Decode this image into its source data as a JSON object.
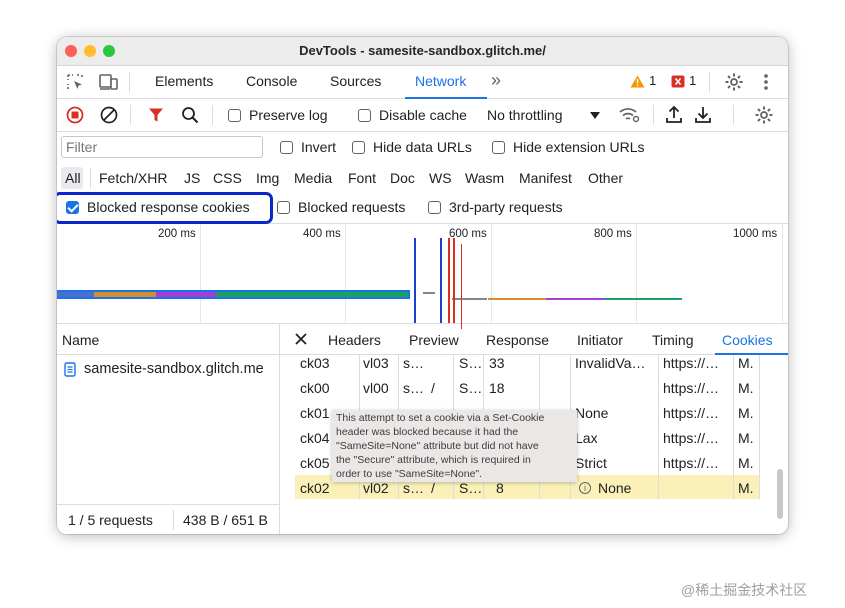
{
  "window": {
    "title": "DevTools - samesite-sandbox.glitch.me/"
  },
  "main_tabs": {
    "items": [
      "Elements",
      "Console",
      "Sources",
      "Network"
    ],
    "active": "Network",
    "more": "»",
    "warnings": "1",
    "errors": "1"
  },
  "toolbar": {
    "preserve_log": "Preserve log",
    "disable_cache": "Disable cache",
    "throttling": "No throttling"
  },
  "filters": {
    "placeholder": "Filter",
    "invert": "Invert",
    "hide_data_urls": "Hide data URLs",
    "hide_extension_urls": "Hide extension URLs",
    "types": [
      "All",
      "Fetch/XHR",
      "JS",
      "CSS",
      "Img",
      "Media",
      "Font",
      "Doc",
      "WS",
      "Wasm",
      "Manifest",
      "Other"
    ],
    "blocked_response_cookies": "Blocked response cookies",
    "blocked_requests": "Blocked requests",
    "third_party_requests": "3rd-party requests"
  },
  "timeline": {
    "ticks": [
      "200 ms",
      "400 ms",
      "600 ms",
      "800 ms",
      "1000 ms"
    ],
    "colors": {
      "blue": "#4a6fd1",
      "orange": "#d98c2b",
      "purple": "#a33fd4",
      "green": "#1aa260",
      "red": "#d93025"
    }
  },
  "requests": {
    "header": "Name",
    "items": [
      "samesite-sandbox.glitch.me"
    ],
    "status": "1 / 5 requests",
    "size": "438 B / 651 B"
  },
  "detail_tabs": {
    "items": [
      "Headers",
      "Preview",
      "Response",
      "Initiator",
      "Timing",
      "Cookies"
    ],
    "active": "Cookies"
  },
  "cookies": {
    "rows": [
      {
        "name": "ck03",
        "value": "vl03",
        "domain": "s…",
        "path": "",
        "expires": "S…",
        "size": "33",
        "samesite": "InvalidVa…",
        "partition": "https://…",
        "priority": "M.",
        "info": false
      },
      {
        "name": "ck00",
        "value": "vl00",
        "domain": "s…",
        "path": "/",
        "expires": "S…",
        "size": "18",
        "samesite": "",
        "partition": "https://…",
        "priority": "M.",
        "info": false
      },
      {
        "name": "ck01",
        "value": "",
        "domain": "",
        "path": "",
        "expires": "",
        "size": "",
        "samesite": "None",
        "partition": "https://…",
        "priority": "M.",
        "info": false
      },
      {
        "name": "ck04",
        "value": "",
        "domain": "",
        "path": "",
        "expires": "",
        "size": "",
        "samesite": "Lax",
        "partition": "https://…",
        "priority": "M.",
        "info": false
      },
      {
        "name": "ck05",
        "value": "",
        "domain": "",
        "path": "",
        "expires": "",
        "size": "",
        "samesite": "Strict",
        "partition": "https://…",
        "priority": "M.",
        "info": false
      },
      {
        "name": "ck02",
        "value": "vl02",
        "domain": "s…",
        "path": "/",
        "expires": "S…",
        "size": "8",
        "samesite": "None",
        "partition": "",
        "priority": "M.",
        "info": true
      }
    ],
    "tooltip": [
      "This attempt to set a cookie via a Set-Cookie",
      "header was blocked because it had the",
      "\"SameSite=None\" attribute but did not have",
      "the \"Secure\" attribute, which is required in",
      "order to use \"SameSite=None\"."
    ]
  },
  "watermark": "@稀土掘金技术社区"
}
